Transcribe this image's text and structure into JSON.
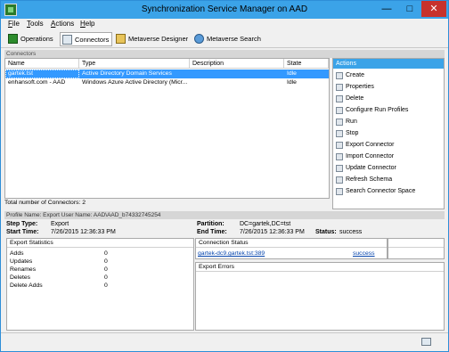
{
  "window": {
    "title": "Synchronization Service Manager on AAD"
  },
  "menu": [
    {
      "label": "File",
      "u": "F",
      "rest": "ile"
    },
    {
      "label": "Tools",
      "u": "T",
      "rest": "ools"
    },
    {
      "label": "Actions",
      "u": "A",
      "rest": "ctions"
    },
    {
      "label": "Help",
      "u": "H",
      "rest": "elp"
    }
  ],
  "toolbar": {
    "operations": "Operations",
    "connectors": "Connectors",
    "metaverse_designer": "Metaverse Designer",
    "metaverse_search": "Metaverse Search"
  },
  "connectors": {
    "section_title": "Connectors",
    "columns": {
      "name": "Name",
      "type": "Type",
      "description": "Description",
      "state": "State"
    },
    "rows": [
      {
        "name": "gartek.tst",
        "type": "Active Directory Domain Services",
        "description": "",
        "state": "Idle"
      },
      {
        "name": "enhansoft.com - AAD",
        "type": "Windows Azure Active Directory (Micr...",
        "description": "",
        "state": "Idle"
      }
    ],
    "total": "Total number of Connectors: 2"
  },
  "actions": {
    "title": "Actions",
    "items": [
      "Create",
      "Properties",
      "Delete",
      "Configure Run Profiles",
      "Run",
      "Stop",
      "Export Connector",
      "Import Connector",
      "Update Connector",
      "Refresh Schema",
      "Search Connector Space"
    ]
  },
  "profile": {
    "header": "Profile Name: Export  User Name: AAD\\AAD_b74332745254",
    "step_type_label": "Step Type:",
    "step_type": "Export",
    "start_time_label": "Start Time:",
    "start_time": "7/26/2015 12:36:33 PM",
    "partition_label": "Partition:",
    "partition": "DC=gartek,DC=tst",
    "end_time_label": "End Time:",
    "end_time": "7/26/2015 12:36:33 PM",
    "status_label": "Status:",
    "status": "success"
  },
  "export_statistics": {
    "title": "Export Statistics",
    "rows": [
      {
        "label": "Adds",
        "value": "0"
      },
      {
        "label": "Updates",
        "value": "0"
      },
      {
        "label": "Renames",
        "value": "0"
      },
      {
        "label": "Deletes",
        "value": "0"
      },
      {
        "label": "Delete Adds",
        "value": "0"
      }
    ]
  },
  "connection_status": {
    "title": "Connection Status",
    "server": "gartek-dc9.gartek.tst:389",
    "result": "success"
  },
  "export_errors": {
    "title": "Export Errors"
  }
}
